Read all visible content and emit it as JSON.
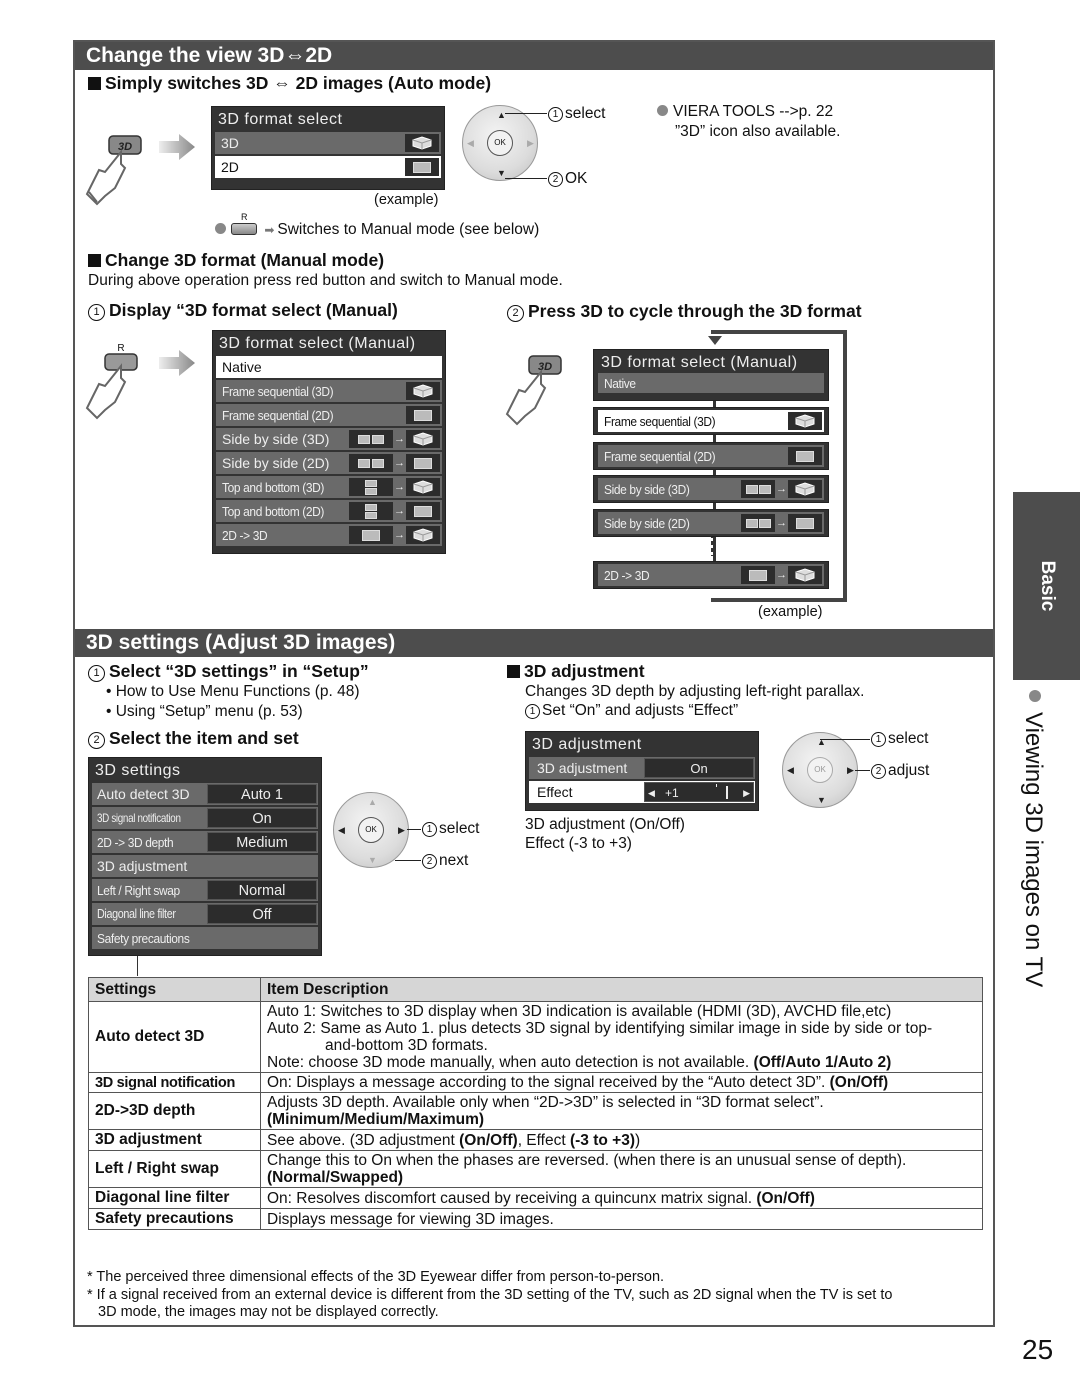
{
  "section1": {
    "title": "Change the view 3D⇔2D",
    "auto": {
      "heading": "Simply switches 3D ⇔ 2D images (Auto mode)",
      "menu": {
        "title": "3D format select",
        "items": [
          {
            "label": "3D",
            "icon": "cube-3d-icon",
            "selected": false
          },
          {
            "label": "2D",
            "icon": "flat-2d-icon",
            "selected": true
          }
        ]
      },
      "example": "(example)",
      "remote": {
        "step1_num": "1",
        "step1": "select",
        "step2_num": "2",
        "step2": "OK",
        "ok": "OK"
      },
      "note_viera": "VIERA TOOLS -->p. 22",
      "note_viera2": "”3D” icon also available.",
      "red_button_label": "R",
      "red_note": "Switches to Manual mode (see below)"
    },
    "manual": {
      "heading": "Change 3D format (Manual mode)",
      "desc": "During above operation press red button and switch to Manual mode.",
      "step1_num": "1",
      "step1": "Display “3D format select (Manual)",
      "step2_num": "2",
      "step2": "Press 3D to cycle through the 3D format",
      "red_button_label": "R",
      "menu": {
        "title": "3D format select (Manual)",
        "items": [
          {
            "label": "Native",
            "icon": "none"
          },
          {
            "label": "Frame sequential (3D)",
            "icon": "cube-3d-icon"
          },
          {
            "label": "Frame sequential (2D)",
            "icon": "flat-2d-icon"
          },
          {
            "label": "Side by side (3D)",
            "icon": "side-by-side-to-3d-icon"
          },
          {
            "label": "Side by side (2D)",
            "icon": "side-by-side-to-2d-icon"
          },
          {
            "label": "Top and bottom (3D)",
            "icon": "top-bottom-to-3d-icon"
          },
          {
            "label": "Top and bottom (2D)",
            "icon": "top-bottom-to-2d-icon"
          },
          {
            "label": "2D -> 3D",
            "icon": "2d-to-3d-icon"
          }
        ]
      },
      "cycle_menu": {
        "title": "3D format select (Manual)",
        "items": [
          "Native",
          "Frame sequential (3D)",
          "Frame sequential (2D)",
          "Side by side (3D)",
          "Side by side (2D)",
          "2D -> 3D"
        ]
      },
      "example": "(example)"
    }
  },
  "section2": {
    "title": "3D settings (Adjust 3D images)",
    "step1_num": "1",
    "step1": "Select “3D settings” in “Setup”",
    "bullets": [
      "How to Use Menu Functions (p. 48)",
      "Using “Setup” menu (p. 53)"
    ],
    "step2_num": "2",
    "step2": "Select the item and set",
    "menu": {
      "title": "3D settings",
      "rows": [
        {
          "label": "Auto detect 3D",
          "value": "Auto 1"
        },
        {
          "label": "3D signal notification",
          "value": "On"
        },
        {
          "label": "2D -> 3D depth",
          "value": "Medium"
        },
        {
          "label": "3D adjustment",
          "value": ""
        },
        {
          "label": "Left / Right swap",
          "value": "Normal"
        },
        {
          "label": "Diagonal line filter",
          "value": "Off"
        },
        {
          "label": "Safety precautions",
          "value": ""
        }
      ]
    },
    "remote": {
      "step1_num": "1",
      "step1": "select",
      "step2_num": "2",
      "step2": "next",
      "ok": "OK"
    },
    "adjust": {
      "heading": "3D adjustment",
      "desc": "Changes 3D depth by adjusting left-right parallax.",
      "step_num": "1",
      "step": "Set “On” and adjusts “Effect”",
      "menu": {
        "title": "3D adjustment",
        "row1_label": "3D adjustment",
        "row1_value": "On",
        "row2_label": "Effect",
        "row2_value": "+1",
        "effect_level": 1,
        "effect_range": [
          -3,
          3
        ]
      },
      "remote": {
        "step1_num": "1",
        "step1": "select",
        "step2_num": "2",
        "step2": "adjust",
        "ok": "OK"
      },
      "note1": "3D adjustment (On/Off)",
      "note2": "Effect (-3 to +3)"
    },
    "table": {
      "headers": [
        "Settings",
        "Item Description"
      ],
      "rows": [
        {
          "key": "Auto detect 3D",
          "lines": [
            "Auto 1: Switches to 3D display when 3D indication is available (HDMI (3D), AVCHD file,etc)",
            "Auto 2: Same as Auto 1. plus detects 3D signal by identifying similar image in side by side or top-",
            "and-bottom 3D formats.",
            "Note: choose 3D mode manually, when auto detection is not available. "
          ],
          "bold": "(Off/Auto 1/Auto 2)"
        },
        {
          "key": "3D signal notification",
          "lines": [
            "On: Displays a message according to the signal received by the “Auto detect 3D”. "
          ],
          "bold": "(On/Off)"
        },
        {
          "key": "2D->3D depth",
          "lines": [
            "Adjusts 3D depth. Available only when “2D->3D” is selected in “3D format select”."
          ],
          "bold": "(Minimum/Medium/Maximum)"
        },
        {
          "key": "3D adjustment",
          "lines": [
            "See above. (3D adjustment "
          ],
          "bold": "(On/Off)",
          "mid": ", Effect ",
          "bold2": "(-3 to +3)",
          "tail": ")"
        },
        {
          "key": "Left / Right swap",
          "lines": [
            "Change this to On when the phases are reversed. (when there is an unusual sense of depth)."
          ],
          "bold": "(Normal/Swapped)"
        },
        {
          "key": "Diagonal line filter",
          "lines": [
            "On: Resolves discomfort caused by receiving a quincunx matrix signal. "
          ],
          "bold": "(On/Off)"
        },
        {
          "key": "Safety precautions",
          "lines": [
            "Displays message for viewing 3D images."
          ],
          "bold": ""
        }
      ]
    },
    "footnotes": [
      "* The perceived three dimensional effects of the 3D Eyewear differ from person-to-person.",
      "* If a signal received from an external device is different from the 3D setting of the TV, such as 2D signal when the TV is set to",
      "3D mode, the images may not be displayed correctly."
    ]
  },
  "side": {
    "tab": "Basic",
    "label": "Viewing 3D images on TV"
  },
  "page_number": "25",
  "colors": {
    "header_bg": "#4d4d4d",
    "osd_bg": "#333333",
    "osd_row": "#6a6a6a",
    "table_head": "#d6d6d6",
    "bullet": "#888888"
  }
}
